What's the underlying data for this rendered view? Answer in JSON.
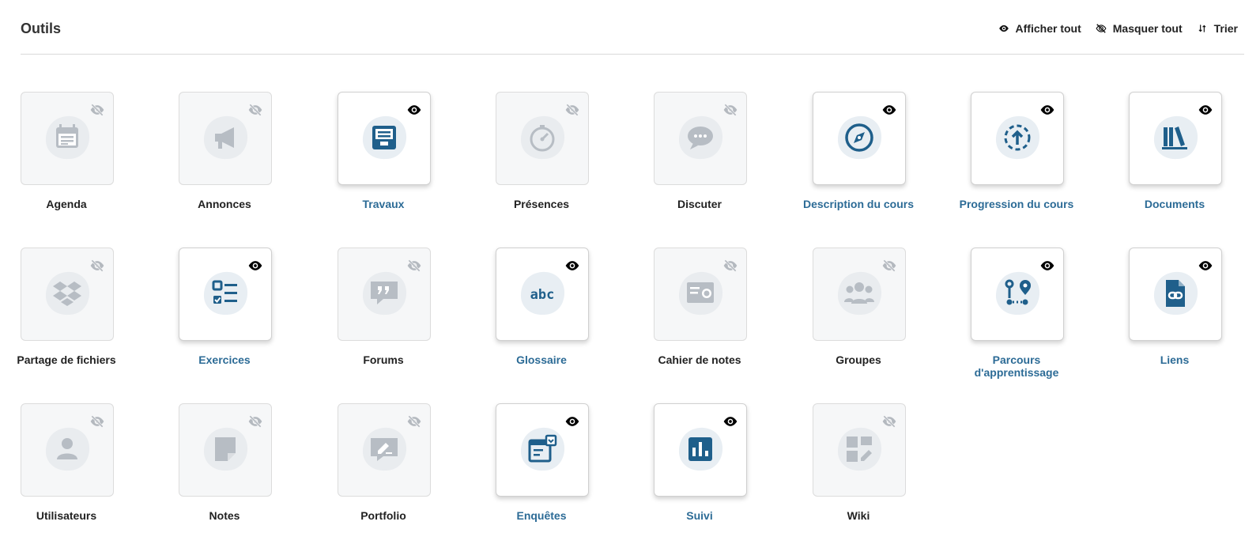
{
  "header": {
    "title": "Outils",
    "show_all": "Afficher tout",
    "hide_all": "Masquer tout",
    "sort": "Trier"
  },
  "colors": {
    "accent": "#2c6b96",
    "icon_visible": "#1f5f8b",
    "icon_hidden": "#b7bdc4",
    "blob": "#e8eef3"
  },
  "tools": [
    {
      "label": "Agenda",
      "visible": false,
      "icon": "calendar-icon"
    },
    {
      "label": "Annonces",
      "visible": false,
      "icon": "megaphone-icon"
    },
    {
      "label": "Travaux",
      "visible": true,
      "icon": "assignment-inbox-icon"
    },
    {
      "label": "Présences",
      "visible": false,
      "icon": "stopwatch-icon"
    },
    {
      "label": "Discuter",
      "visible": false,
      "icon": "chat-bubble-icon"
    },
    {
      "label": "Description du cours",
      "visible": true,
      "icon": "compass-icon"
    },
    {
      "label": "Progression du cours",
      "visible": true,
      "icon": "progress-upload-icon"
    },
    {
      "label": "Documents",
      "visible": true,
      "icon": "books-icon"
    },
    {
      "label": "Partage de fichiers",
      "visible": false,
      "icon": "dropbox-icon"
    },
    {
      "label": "Exercices",
      "visible": true,
      "icon": "checklist-icon"
    },
    {
      "label": "Forums",
      "visible": false,
      "icon": "quote-bubble-icon"
    },
    {
      "label": "Glossaire",
      "visible": true,
      "icon": "abc-icon"
    },
    {
      "label": "Cahier de notes",
      "visible": false,
      "icon": "certificate-icon"
    },
    {
      "label": "Groupes",
      "visible": false,
      "icon": "group-icon"
    },
    {
      "label": "Parcours d'apprentissage",
      "visible": true,
      "icon": "learning-path-icon"
    },
    {
      "label": "Liens",
      "visible": true,
      "icon": "file-link-icon"
    },
    {
      "label": "Utilisateurs",
      "visible": false,
      "icon": "user-icon"
    },
    {
      "label": "Notes",
      "visible": false,
      "icon": "note-icon"
    },
    {
      "label": "Portfolio",
      "visible": false,
      "icon": "portfolio-edit-icon"
    },
    {
      "label": "Enquêtes",
      "visible": true,
      "icon": "survey-icon"
    },
    {
      "label": "Suivi",
      "visible": true,
      "icon": "bar-chart-icon"
    },
    {
      "label": "Wiki",
      "visible": false,
      "icon": "wiki-icon"
    }
  ]
}
